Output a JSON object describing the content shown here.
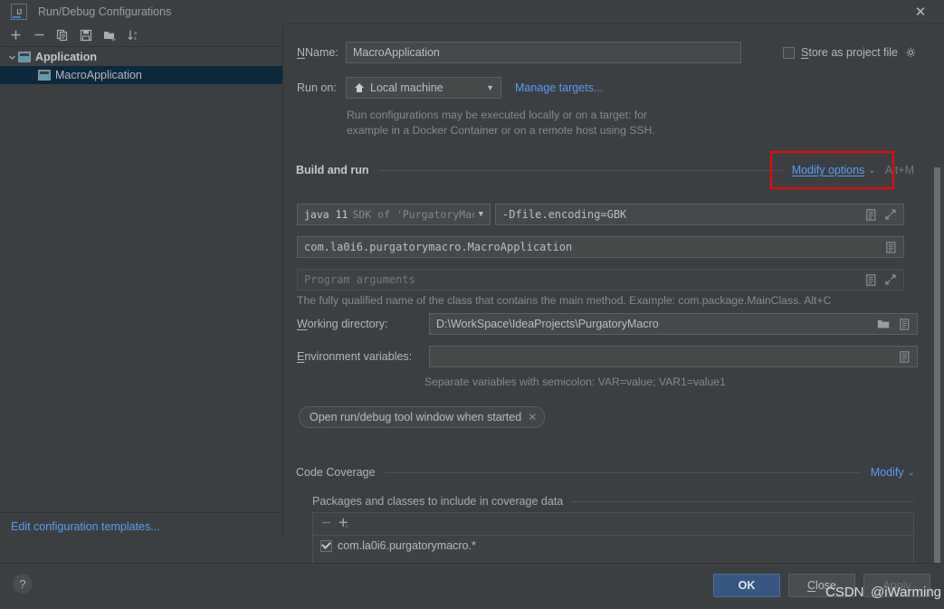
{
  "window": {
    "title": "Run/Debug Configurations",
    "close_label": "✕",
    "logo_text": "IJ"
  },
  "sidebar": {
    "toolbar": [
      {
        "name": "add",
        "glyph": "+"
      },
      {
        "name": "remove",
        "glyph": "−"
      },
      {
        "name": "copy",
        "glyph": "copy"
      },
      {
        "name": "save",
        "glyph": "save"
      },
      {
        "name": "new-folder",
        "glyph": "folder-plus"
      },
      {
        "name": "sort-alphabetically",
        "glyph": "sort-az"
      }
    ],
    "tree": [
      {
        "label": "Application",
        "type": "group",
        "expanded": true,
        "selected": false
      },
      {
        "label": "MacroApplication",
        "type": "item",
        "selected": true
      }
    ],
    "footer_link": "Edit configuration templates..."
  },
  "form": {
    "name_label": "Name:",
    "name_value": "MacroApplication",
    "store_as_project_file_label": "Store as project file",
    "store_as_project_file_checked": false,
    "store_gear_icon": "gear-icon",
    "run_on_label": "Run on:",
    "run_on_value": "Local machine",
    "run_on_icon": "home-icon",
    "manage_targets_link": "Manage targets...",
    "run_on_hint_line1": "Run configurations may be executed locally or on a target: for",
    "run_on_hint_line2": "example in a Docker Container or on a remote host using SSH."
  },
  "build_and_run": {
    "section_title": "Build and run",
    "modify_options_link": "Modify options",
    "modify_options_chevron": "⌄",
    "modify_options_shortcut": "Alt+M",
    "sdk_main": "java 11",
    "sdk_secondary": "SDK of 'PurgatoryMac",
    "vm_options_value": "-Dfile.encoding=GBK",
    "main_class_value": "com.la0i6.purgatorymacro.MacroApplication",
    "program_arguments_placeholder": "Program arguments",
    "main_class_hint": "The fully qualified name of the class that contains the main method. Example: com.package.MainClass. Alt+C",
    "working_directory_label": "Working directory:",
    "working_directory_value": "D:\\WorkSpace\\IdeaProjects\\PurgatoryMacro",
    "environment_variables_label": "Environment variables:",
    "environment_variables_value": "",
    "environment_hint": "Separate variables with semicolon: VAR=value; VAR1=value1",
    "chip_label": "Open run/debug tool window when started",
    "chip_close": "✕"
  },
  "code_coverage": {
    "section_title": "Code Coverage",
    "modify_link": "Modify",
    "modify_chevron": "⌄",
    "subsection_title": "Packages and classes to include in coverage data",
    "toolbar": [
      {
        "name": "remove-package",
        "glyph": "−"
      },
      {
        "name": "add-package",
        "glyph": "+"
      }
    ],
    "items": [
      {
        "label": "com.la0i6.purgatorymacro.*",
        "checked": true
      }
    ]
  },
  "footer": {
    "help_label": "?",
    "ok_label": "OK",
    "close_label": "Close",
    "apply_label": "Apply",
    "apply_disabled": true
  },
  "watermark": {
    "text1": "CSDN",
    "text2": "@iWarming"
  },
  "colors": {
    "background": "#3c3f41",
    "field_background": "#45494a",
    "accent_link": "#589df6",
    "primary_button": "#365880",
    "selection": "#0d293e",
    "highlight_border": "#fe0000"
  }
}
